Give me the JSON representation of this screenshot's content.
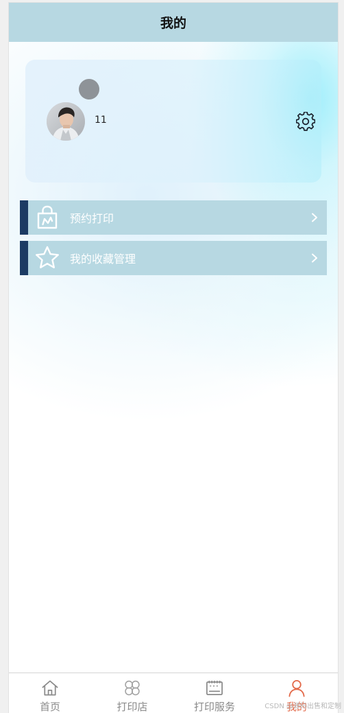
{
  "header": {
    "title": "我的"
  },
  "profile": {
    "username": "11"
  },
  "menu": [
    {
      "label": "预约打印",
      "icon": "shopping-bag-icon"
    },
    {
      "label": "我的收藏管理",
      "icon": "star-icon"
    }
  ],
  "tabbar": [
    {
      "label": "首页",
      "icon": "home-icon"
    },
    {
      "label": "打印店",
      "icon": "grid-clover-icon"
    },
    {
      "label": "打印服务",
      "icon": "printer-icon"
    },
    {
      "label": "我的",
      "icon": "user-icon",
      "active": true
    }
  ],
  "watermark": "CSDN @源码出售和定制",
  "colors": {
    "header_bg": "#b7d8e2",
    "menu_bg": "#b7d8e2",
    "menu_accent": "#1c3b63",
    "tab_active": "#e36a4a",
    "tab_inactive": "#8a8a8a"
  }
}
